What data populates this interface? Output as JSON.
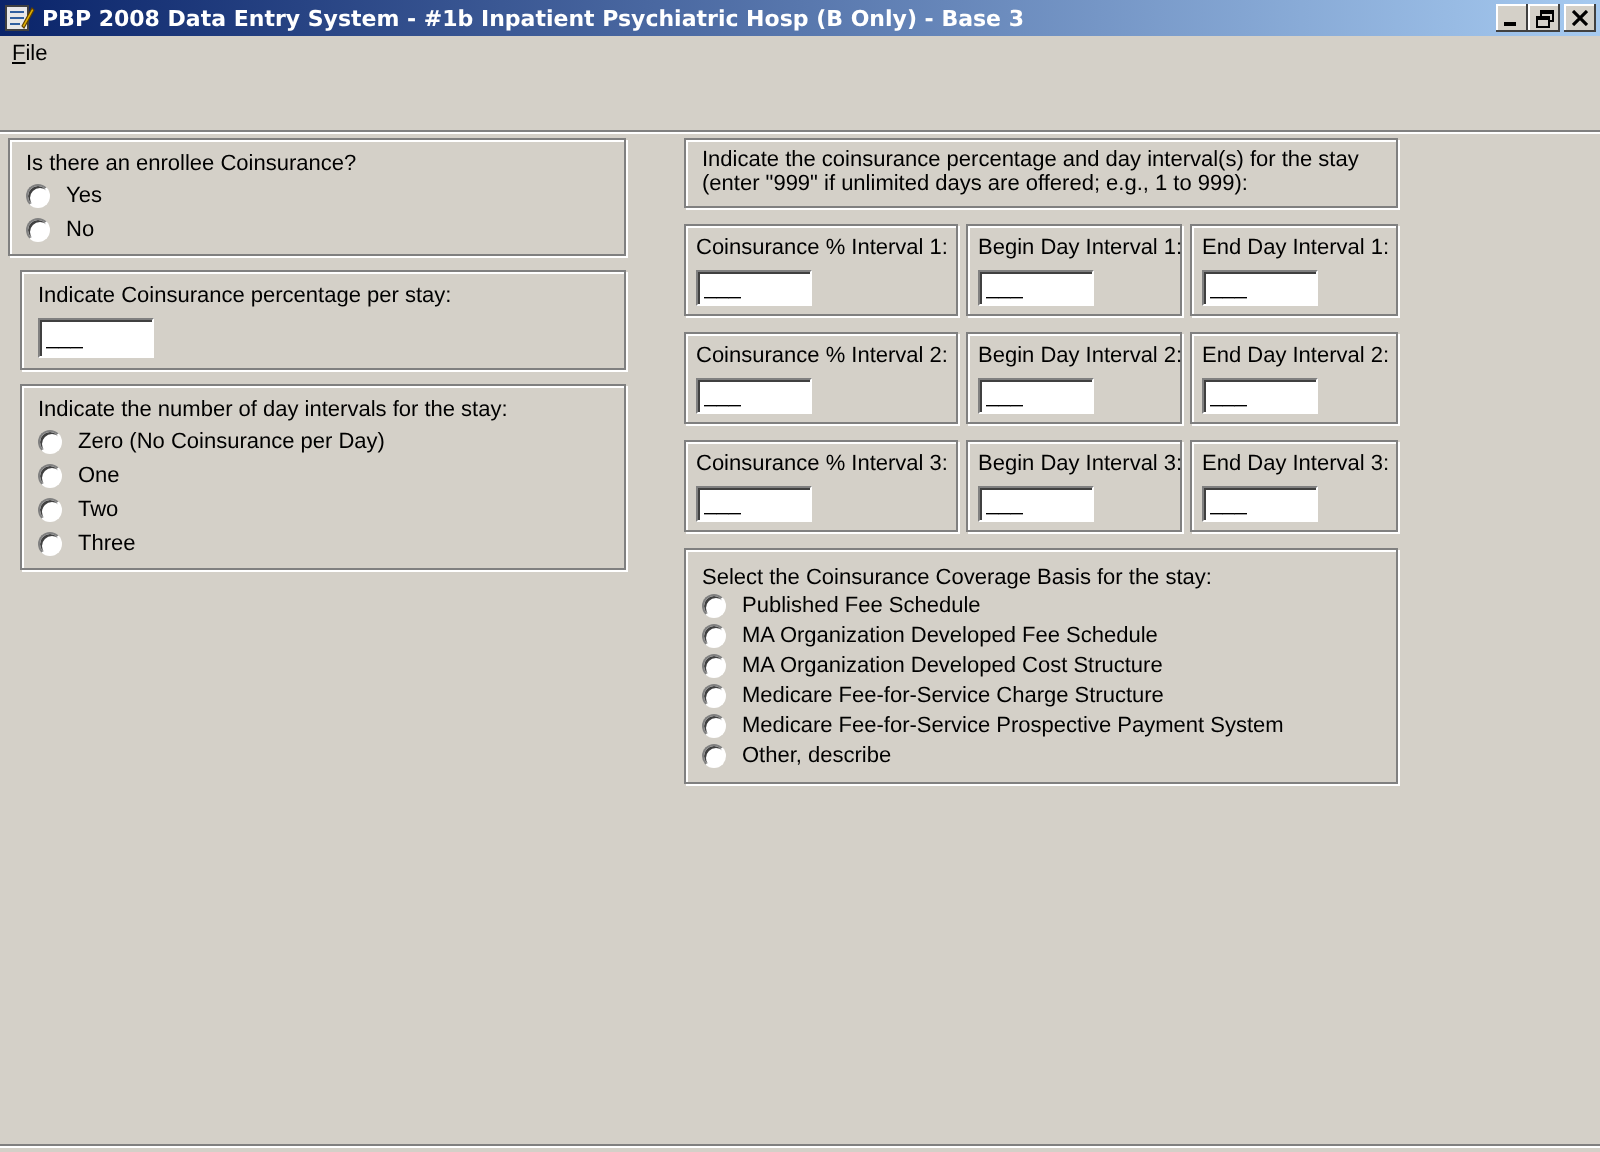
{
  "window": {
    "title": "PBP 2008 Data Entry System - #1b Inpatient Psychiatric Hosp (B Only) - Base 3"
  },
  "menu": [
    {
      "label": "File"
    }
  ],
  "left_panels": [
    {
      "kind": "radio",
      "label": "Is there an enrollee Coinsurance?",
      "options": [
        {
          "label": "Yes",
          "selected": false
        },
        {
          "label": "No",
          "selected": false
        }
      ]
    },
    {
      "kind": "field",
      "label": "Indicate Coinsurance percentage per stay:",
      "value": "___"
    },
    {
      "kind": "radio",
      "label": "Indicate the number of day intervals for the stay:",
      "options": [
        {
          "label": "Zero (No Coinsurance per Day)",
          "selected": false
        },
        {
          "label": "One",
          "selected": false
        },
        {
          "label": "Two",
          "selected": false
        },
        {
          "label": "Three",
          "selected": false
        }
      ]
    }
  ],
  "interval_header": "Indicate the coinsurance percentage and day interval(s) for the stay (enter \"999\" if unlimited days are offered; e.g., 1 to 999):",
  "interval_fields": [
    [
      {
        "label": "Coinsurance % Interval 1:",
        "value": "___"
      },
      {
        "label": "Begin Day Interval 1:",
        "value": "___"
      },
      {
        "label": "End Day Interval 1:",
        "value": "___"
      }
    ],
    [
      {
        "label": "Coinsurance % Interval 2:",
        "value": "___"
      },
      {
        "label": "Begin Day Interval 2:",
        "value": "___"
      },
      {
        "label": "End Day Interval 2:",
        "value": "___"
      }
    ],
    [
      {
        "label": "Coinsurance % Interval 3:",
        "value": "___"
      },
      {
        "label": "Begin Day Interval 3:",
        "value": "___"
      },
      {
        "label": "End Day Interval 3:",
        "value": "___"
      }
    ]
  ],
  "coverage_basis": {
    "label": "Select the Coinsurance Coverage Basis for the stay:",
    "options": [
      {
        "label": "Published Fee Schedule",
        "selected": false
      },
      {
        "label": "MA Organization Developed Fee Schedule",
        "selected": false
      },
      {
        "label": "MA Organization Developed Cost Structure",
        "selected": false
      },
      {
        "label": "Medicare Fee-for-Service Charge Structure",
        "selected": false
      },
      {
        "label": "Medicare Fee-for-Service Prospective Payment System",
        "selected": false
      },
      {
        "label": "Other, describe",
        "selected": false
      }
    ]
  }
}
